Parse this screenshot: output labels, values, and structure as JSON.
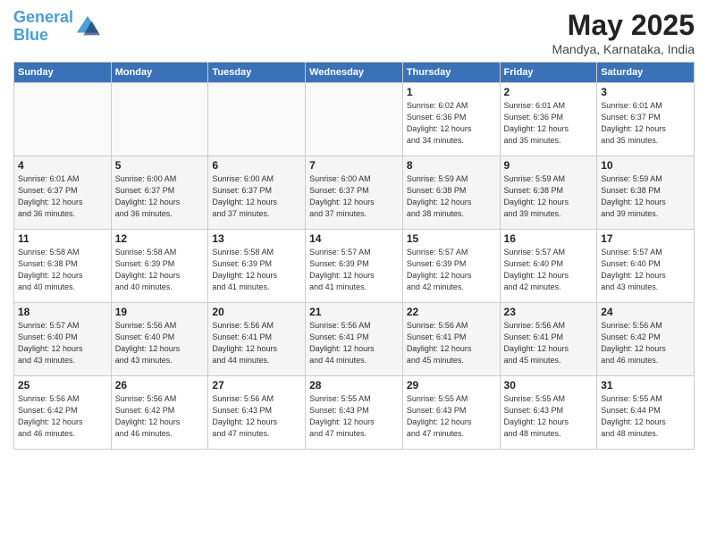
{
  "logo": {
    "line1": "General",
    "line2": "Blue"
  },
  "title": "May 2025",
  "subtitle": "Mandya, Karnataka, India",
  "weekdays": [
    "Sunday",
    "Monday",
    "Tuesday",
    "Wednesday",
    "Thursday",
    "Friday",
    "Saturday"
  ],
  "weeks": [
    [
      {
        "day": "",
        "info": ""
      },
      {
        "day": "",
        "info": ""
      },
      {
        "day": "",
        "info": ""
      },
      {
        "day": "",
        "info": ""
      },
      {
        "day": "1",
        "info": "Sunrise: 6:02 AM\nSunset: 6:36 PM\nDaylight: 12 hours\nand 34 minutes."
      },
      {
        "day": "2",
        "info": "Sunrise: 6:01 AM\nSunset: 6:36 PM\nDaylight: 12 hours\nand 35 minutes."
      },
      {
        "day": "3",
        "info": "Sunrise: 6:01 AM\nSunset: 6:37 PM\nDaylight: 12 hours\nand 35 minutes."
      }
    ],
    [
      {
        "day": "4",
        "info": "Sunrise: 6:01 AM\nSunset: 6:37 PM\nDaylight: 12 hours\nand 36 minutes."
      },
      {
        "day": "5",
        "info": "Sunrise: 6:00 AM\nSunset: 6:37 PM\nDaylight: 12 hours\nand 36 minutes."
      },
      {
        "day": "6",
        "info": "Sunrise: 6:00 AM\nSunset: 6:37 PM\nDaylight: 12 hours\nand 37 minutes."
      },
      {
        "day": "7",
        "info": "Sunrise: 6:00 AM\nSunset: 6:37 PM\nDaylight: 12 hours\nand 37 minutes."
      },
      {
        "day": "8",
        "info": "Sunrise: 5:59 AM\nSunset: 6:38 PM\nDaylight: 12 hours\nand 38 minutes."
      },
      {
        "day": "9",
        "info": "Sunrise: 5:59 AM\nSunset: 6:38 PM\nDaylight: 12 hours\nand 39 minutes."
      },
      {
        "day": "10",
        "info": "Sunrise: 5:59 AM\nSunset: 6:38 PM\nDaylight: 12 hours\nand 39 minutes."
      }
    ],
    [
      {
        "day": "11",
        "info": "Sunrise: 5:58 AM\nSunset: 6:38 PM\nDaylight: 12 hours\nand 40 minutes."
      },
      {
        "day": "12",
        "info": "Sunrise: 5:58 AM\nSunset: 6:39 PM\nDaylight: 12 hours\nand 40 minutes."
      },
      {
        "day": "13",
        "info": "Sunrise: 5:58 AM\nSunset: 6:39 PM\nDaylight: 12 hours\nand 41 minutes."
      },
      {
        "day": "14",
        "info": "Sunrise: 5:57 AM\nSunset: 6:39 PM\nDaylight: 12 hours\nand 41 minutes."
      },
      {
        "day": "15",
        "info": "Sunrise: 5:57 AM\nSunset: 6:39 PM\nDaylight: 12 hours\nand 42 minutes."
      },
      {
        "day": "16",
        "info": "Sunrise: 5:57 AM\nSunset: 6:40 PM\nDaylight: 12 hours\nand 42 minutes."
      },
      {
        "day": "17",
        "info": "Sunrise: 5:57 AM\nSunset: 6:40 PM\nDaylight: 12 hours\nand 43 minutes."
      }
    ],
    [
      {
        "day": "18",
        "info": "Sunrise: 5:57 AM\nSunset: 6:40 PM\nDaylight: 12 hours\nand 43 minutes."
      },
      {
        "day": "19",
        "info": "Sunrise: 5:56 AM\nSunset: 6:40 PM\nDaylight: 12 hours\nand 43 minutes."
      },
      {
        "day": "20",
        "info": "Sunrise: 5:56 AM\nSunset: 6:41 PM\nDaylight: 12 hours\nand 44 minutes."
      },
      {
        "day": "21",
        "info": "Sunrise: 5:56 AM\nSunset: 6:41 PM\nDaylight: 12 hours\nand 44 minutes."
      },
      {
        "day": "22",
        "info": "Sunrise: 5:56 AM\nSunset: 6:41 PM\nDaylight: 12 hours\nand 45 minutes."
      },
      {
        "day": "23",
        "info": "Sunrise: 5:56 AM\nSunset: 6:41 PM\nDaylight: 12 hours\nand 45 minutes."
      },
      {
        "day": "24",
        "info": "Sunrise: 5:56 AM\nSunset: 6:42 PM\nDaylight: 12 hours\nand 46 minutes."
      }
    ],
    [
      {
        "day": "25",
        "info": "Sunrise: 5:56 AM\nSunset: 6:42 PM\nDaylight: 12 hours\nand 46 minutes."
      },
      {
        "day": "26",
        "info": "Sunrise: 5:56 AM\nSunset: 6:42 PM\nDaylight: 12 hours\nand 46 minutes."
      },
      {
        "day": "27",
        "info": "Sunrise: 5:56 AM\nSunset: 6:43 PM\nDaylight: 12 hours\nand 47 minutes."
      },
      {
        "day": "28",
        "info": "Sunrise: 5:55 AM\nSunset: 6:43 PM\nDaylight: 12 hours\nand 47 minutes."
      },
      {
        "day": "29",
        "info": "Sunrise: 5:55 AM\nSunset: 6:43 PM\nDaylight: 12 hours\nand 47 minutes."
      },
      {
        "day": "30",
        "info": "Sunrise: 5:55 AM\nSunset: 6:43 PM\nDaylight: 12 hours\nand 48 minutes."
      },
      {
        "day": "31",
        "info": "Sunrise: 5:55 AM\nSunset: 6:44 PM\nDaylight: 12 hours\nand 48 minutes."
      }
    ]
  ]
}
